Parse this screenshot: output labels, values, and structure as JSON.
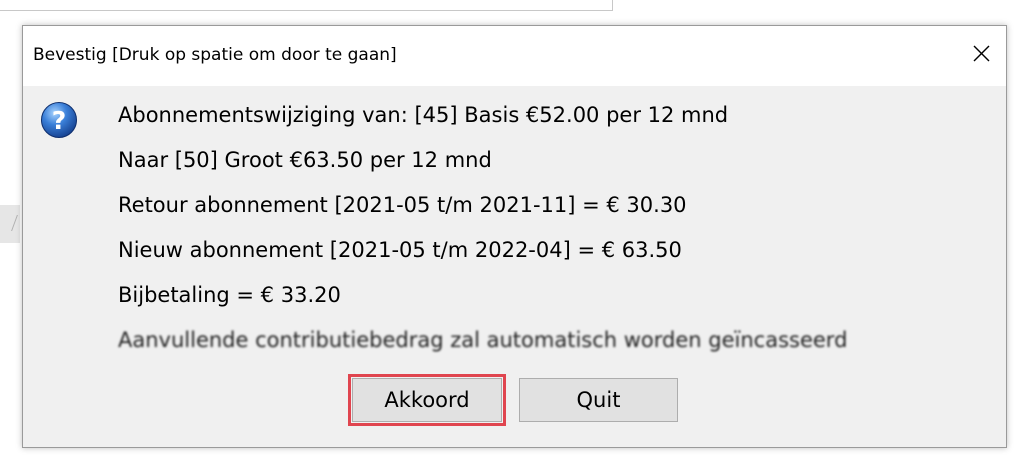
{
  "dialog": {
    "title": "Bevestig [Druk op spatie om door te gaan]",
    "close_icon": "close-icon",
    "icon": "question-icon",
    "message_lines": [
      "Abonnementswijziging van: [45] Basis €52.00 per 12 mnd",
      "Naar [50] Groot €63.50 per 12 mnd",
      "Retour abonnement [2021-05 t/m 2021-11] = € 30.30",
      "Nieuw abonnement [2021-05 t/m 2022-04] = € 63.50",
      "Bijbetaling = € 33.20",
      "Aanvullende contributiebedrag zal automatisch worden geïncasseerd"
    ],
    "buttons": {
      "confirm_label": "Akkoord",
      "quit_label": "Quit"
    },
    "highlight_color": "#e0454f"
  }
}
